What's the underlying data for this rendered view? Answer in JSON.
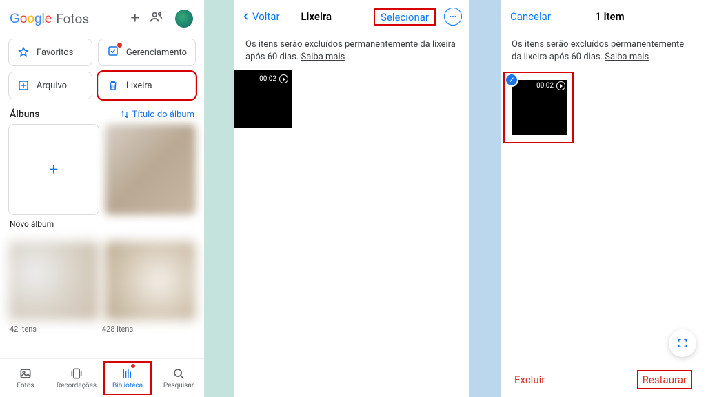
{
  "panel1": {
    "logo_fotos": "Fotos",
    "chips": {
      "favoritos": "Favoritos",
      "gerenciamento": "Gerenciamento",
      "arquivo": "Arquivo",
      "lixeira": "Lixeira"
    },
    "albums_heading": "Álbuns",
    "albums_sort": "Título do álbum",
    "new_album_label": "Novo álbum",
    "counts": {
      "left": "42 itens",
      "right": "428 itens"
    },
    "tabs": {
      "fotos": "Fotos",
      "recordacoes": "Recordações",
      "biblioteca": "Biblioteca",
      "pesquisar": "Pesquisar"
    }
  },
  "panel2": {
    "back": "Voltar",
    "title": "Lixeira",
    "select": "Selecionar",
    "info_pre": "Os itens serão excluídos permanentemente da lixeira após 60 dias. ",
    "info_more": "Saiba mais",
    "video_duration": "00:02"
  },
  "panel3": {
    "cancel": "Cancelar",
    "title": "1 item",
    "info_pre": "Os itens serão excluídos permanentemente da lixeira após 60 dias. ",
    "info_more": "Saiba mais",
    "video_duration": "00:02",
    "delete": "Excluir",
    "restore": "Restaurar"
  }
}
